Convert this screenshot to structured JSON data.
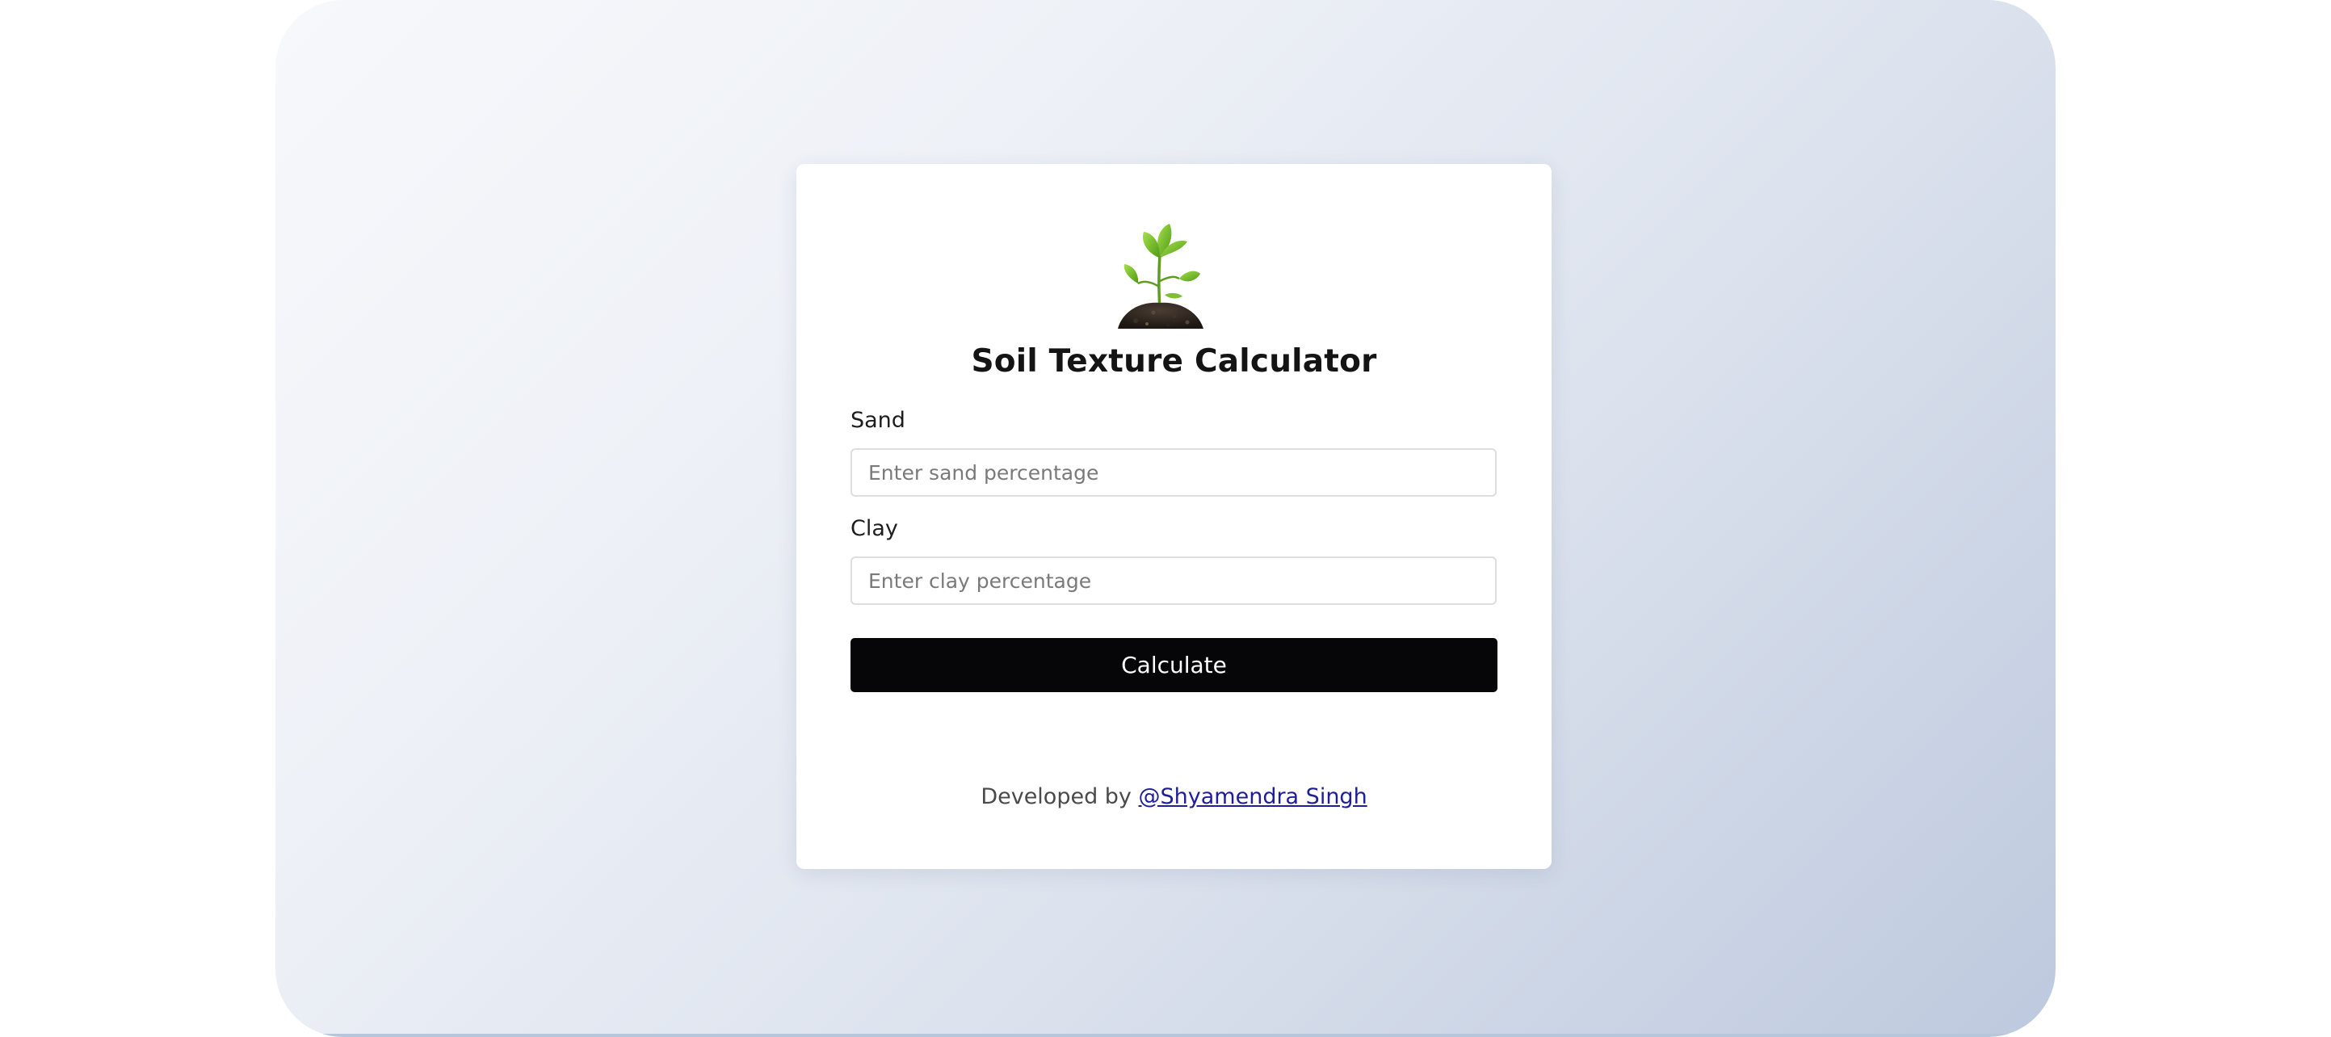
{
  "app": {
    "title": "Soil Texture Calculator",
    "logo_icon": "plant-seedling-icon"
  },
  "form": {
    "sand": {
      "label": "Sand",
      "placeholder": "Enter sand percentage",
      "value": ""
    },
    "clay": {
      "label": "Clay",
      "placeholder": "Enter clay percentage",
      "value": ""
    },
    "submit_label": "Calculate"
  },
  "footer": {
    "prefix": "Developed by",
    "author_link": "@Shyamendra Singh"
  },
  "colors": {
    "button_bg": "#060608",
    "link": "#1e1e9c",
    "leaf": "#7cc52b",
    "soil": "#2b231d"
  }
}
